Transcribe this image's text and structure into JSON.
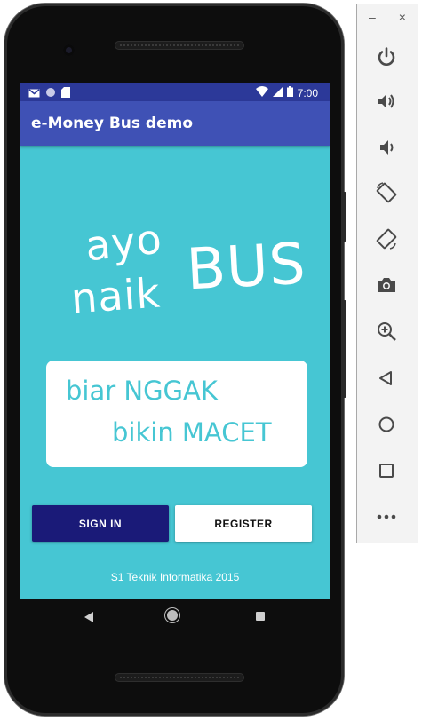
{
  "status_bar": {
    "time": "7:00",
    "icons": [
      "gmail-icon",
      "sync-icon",
      "sd-card-icon",
      "wifi-icon",
      "signal-icon",
      "battery-icon"
    ]
  },
  "app_bar": {
    "title": "e-Money Bus demo"
  },
  "logo": {
    "ayo": "ayo",
    "naik": "naik",
    "bus": "BUS"
  },
  "tagline": {
    "line1": "biar NGGAK",
    "line2": "bikin MACET"
  },
  "buttons": {
    "sign_in": "SIGN IN",
    "register": "REGISTER"
  },
  "footer": {
    "text": "S1 Teknik Informatika 2015"
  },
  "colors": {
    "status_bar": "#2c3999",
    "app_bar": "#3f51b5",
    "background": "#46c6d3",
    "sign_in": "#1a1a78"
  },
  "nav_bar": {
    "icons": [
      "back-icon",
      "home-icon",
      "recents-icon"
    ]
  },
  "emulator_panel": {
    "window_controls": {
      "minimize": "–",
      "close": "×"
    },
    "tools": [
      "power-icon",
      "volume-up-icon",
      "volume-down-icon",
      "rotate-left-icon",
      "rotate-right-icon",
      "screenshot-icon",
      "zoom-icon",
      "back-icon",
      "home-icon",
      "overview-icon",
      "more-icon"
    ]
  }
}
